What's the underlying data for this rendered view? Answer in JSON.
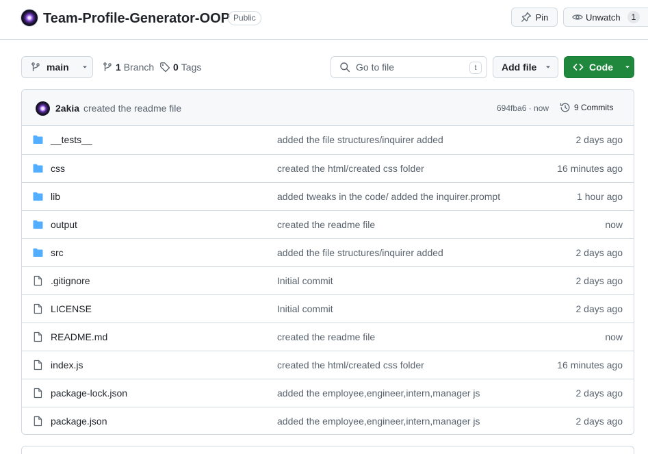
{
  "repo": {
    "name": "Team-Profile-Generator-OOP",
    "visibility": "Public",
    "pin_label": "Pin",
    "unwatch_label": "Unwatch",
    "watch_count": "1"
  },
  "toolbar": {
    "branch": "main",
    "branches_count": "1",
    "branches_label": "Branch",
    "tags_count": "0",
    "tags_label": "Tags",
    "search_placeholder": "Go to file",
    "search_shortcut": "t",
    "add_file_label": "Add file",
    "code_label": "Code"
  },
  "latest_commit": {
    "author": "2akia",
    "message": "created the readme file",
    "hash_time": "694fba6 · now",
    "commits_label": "9 Commits"
  },
  "files": [
    {
      "name": "__tests__",
      "type": "folder",
      "commit": "added the file structures/inquirer added",
      "age": "2 days ago"
    },
    {
      "name": "css",
      "type": "folder",
      "commit": "created the html/created css folder",
      "age": "16 minutes ago"
    },
    {
      "name": "lib",
      "type": "folder",
      "commit": "added tweaks in the code/ added the inquirer.prompt",
      "age": "1 hour ago"
    },
    {
      "name": "output",
      "type": "folder",
      "commit": "created the readme file",
      "age": "now"
    },
    {
      "name": "src",
      "type": "folder",
      "commit": "added the file structures/inquirer added",
      "age": "2 days ago"
    },
    {
      "name": ".gitignore",
      "type": "file",
      "commit": "Initial commit",
      "age": "2 days ago"
    },
    {
      "name": "LICENSE",
      "type": "file",
      "commit": "Initial commit",
      "age": "2 days ago"
    },
    {
      "name": "README.md",
      "type": "file",
      "commit": "created the readme file",
      "age": "now"
    },
    {
      "name": "index.js",
      "type": "file",
      "commit": "created the html/created css folder",
      "age": "16 minutes ago"
    },
    {
      "name": "package-lock.json",
      "type": "file",
      "commit": "added the employee,engineer,intern,manager js",
      "age": "2 days ago"
    },
    {
      "name": "package.json",
      "type": "file",
      "commit": "added the employee,engineer,intern,manager js",
      "age": "2 days ago"
    }
  ],
  "colors": {
    "folder_icon": "#54aeff",
    "file_icon": "#59636e",
    "code_button": "#1f883d",
    "border": "#d1d9e0",
    "muted_text": "#59636e"
  }
}
